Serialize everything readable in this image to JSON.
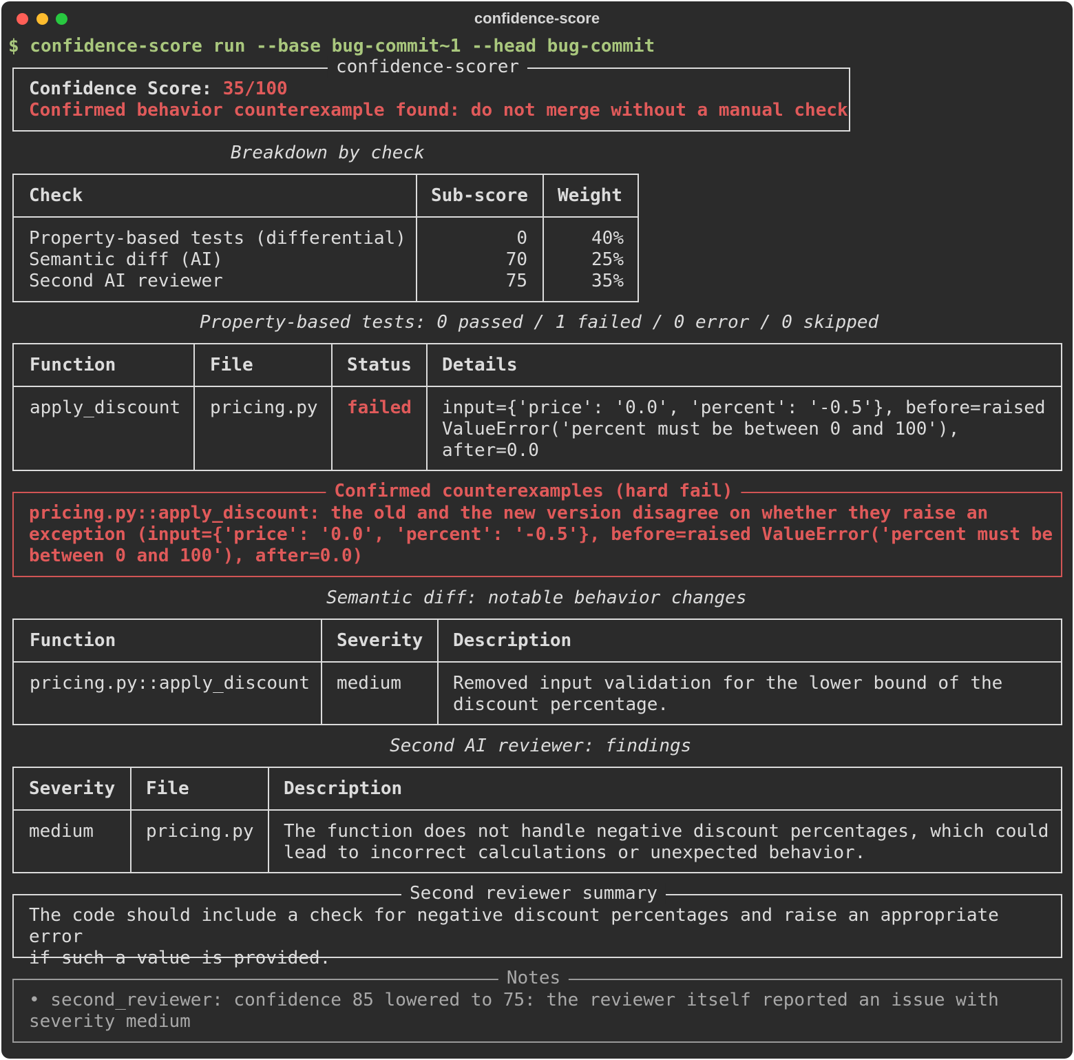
{
  "window": {
    "title": "confidence-score"
  },
  "command": "$ confidence-score run --base bug-commit~1 --head bug-commit",
  "scorer": {
    "legend": "confidence-scorer",
    "score_label": "Confidence Score:",
    "score_value": "35/100",
    "verdict": "Confirmed behavior counterexample found: do not merge without a manual check"
  },
  "breakdown": {
    "caption": "Breakdown by check",
    "headers": [
      "Check",
      "Sub-score",
      "Weight"
    ],
    "rows": [
      [
        "Property-based tests (differential)",
        "0",
        "40%"
      ],
      [
        "Semantic diff (AI)",
        "70",
        "25%"
      ],
      [
        "Second AI reviewer",
        "75",
        "35%"
      ]
    ]
  },
  "pbt": {
    "caption": "Property-based tests: 0 passed / 1 failed / 0 error / 0 skipped",
    "headers": [
      "Function",
      "File",
      "Status",
      "Details"
    ],
    "rows": [
      [
        "apply_discount",
        "pricing.py",
        "failed",
        "input={'price': '0.0', 'percent': '-0.5'}, before=raised\nValueError('percent must be between 0 and 100'),\nafter=0.0"
      ]
    ]
  },
  "counterexamples": {
    "legend": "Confirmed counterexamples (hard fail)",
    "text": "pricing.py::apply_discount: the old and the new version disagree on whether they raise an\nexception (input={'price': '0.0', 'percent': '-0.5'}, before=raised ValueError('percent must be\nbetween 0 and 100'), after=0.0)"
  },
  "semantic": {
    "caption": "Semantic diff: notable behavior changes",
    "headers": [
      "Function",
      "Severity",
      "Description"
    ],
    "rows": [
      [
        "pricing.py::apply_discount",
        "medium",
        "Removed input validation for the lower bound of the\ndiscount percentage."
      ]
    ]
  },
  "reviewer": {
    "caption": "Second AI reviewer: findings",
    "headers": [
      "Severity",
      "File",
      "Description"
    ],
    "rows": [
      [
        "medium",
        "pricing.py",
        "The function does not handle negative discount percentages, which could\nlead to incorrect calculations or unexpected behavior."
      ]
    ]
  },
  "summary": {
    "legend": "Second reviewer summary",
    "text": "The code should include a check for negative discount percentages and raise an appropriate error\nif such a value is provided."
  },
  "notes": {
    "legend": "Notes",
    "text": "• second_reviewer: confidence 85 lowered to 75: the reviewer itself reported an issue with\nseverity medium"
  },
  "colors": {
    "background": "#2b2b2b",
    "text": "#dcdcdc",
    "command": "#a9c77d",
    "error": "#e05a5a"
  }
}
